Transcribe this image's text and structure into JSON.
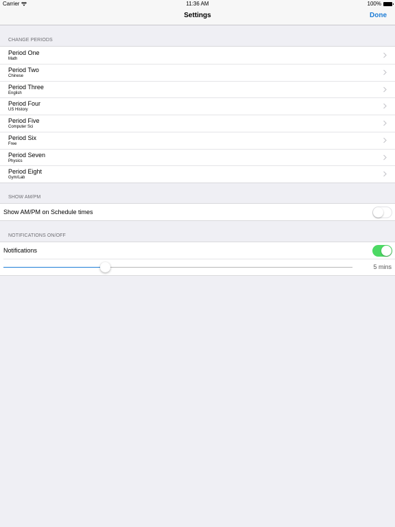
{
  "status_bar": {
    "carrier": "Carrier",
    "time": "11:36 AM",
    "battery": "100%"
  },
  "nav": {
    "title": "Settings",
    "done_label": "Done"
  },
  "sections": {
    "periods": {
      "header": "CHANGE PERIODS",
      "items": [
        {
          "title": "Period One",
          "subject": "Math"
        },
        {
          "title": "Period Two",
          "subject": "Chinese"
        },
        {
          "title": "Period Three",
          "subject": "English"
        },
        {
          "title": "Period Four",
          "subject": "US History"
        },
        {
          "title": "Period Five",
          "subject": "Computer Sci"
        },
        {
          "title": "Period Six",
          "subject": "Free"
        },
        {
          "title": "Period Seven",
          "subject": "Physics"
        },
        {
          "title": "Period Eight",
          "subject": "Gym/Lab"
        }
      ]
    },
    "ampm": {
      "header": "SHOW AM/PM",
      "label": "Show AM/PM on Schedule times",
      "enabled": false
    },
    "notifications": {
      "header": "NOTIFICATIONS ON/OFF",
      "label": "Notifications",
      "enabled": true,
      "slider_fraction": 0.29,
      "slider_value_label": "5 mins"
    }
  },
  "colors": {
    "accent": "#1c7cd6",
    "toggle_on": "#4cd964",
    "background": "#efeff4"
  }
}
